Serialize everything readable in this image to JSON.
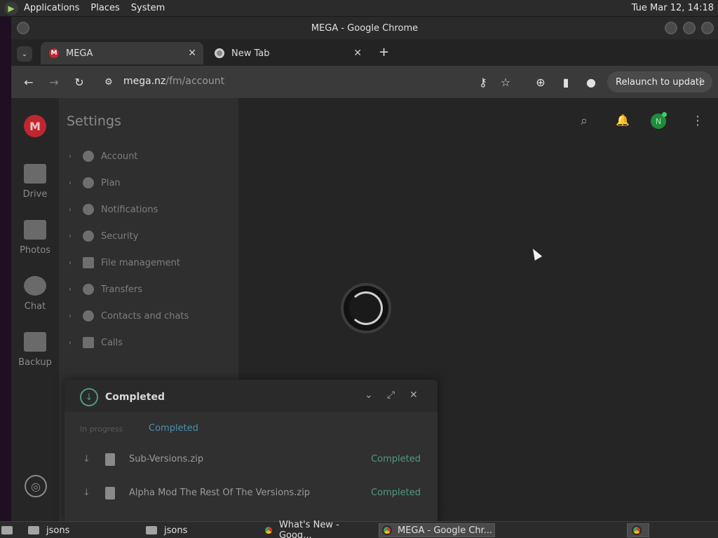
{
  "top_panel": {
    "menus": [
      "Applications",
      "Places",
      "System"
    ],
    "clock": "Tue Mar 12, 14:18"
  },
  "window": {
    "title": "MEGA - Google Chrome"
  },
  "tabs": [
    {
      "label": "MEGA",
      "active": true,
      "favicon": "mega-icon"
    },
    {
      "label": "New Tab",
      "active": false,
      "favicon": "chrome-icon"
    }
  ],
  "toolbar": {
    "url_host": "mega.nz",
    "url_path": "/fm/account",
    "relaunch_label": "Relaunch to update"
  },
  "rail": {
    "logo": "M",
    "items": [
      {
        "label": "Drive",
        "icon": "folder-icon"
      },
      {
        "label": "Photos",
        "icon": "photo-icon"
      },
      {
        "label": "Chat",
        "icon": "chat-bubble-icon"
      },
      {
        "label": "Backup",
        "icon": "device-icon"
      }
    ]
  },
  "settings": {
    "title": "Settings",
    "items": [
      {
        "label": "Account",
        "icon": "user-icon"
      },
      {
        "label": "Plan",
        "icon": "shield-icon"
      },
      {
        "label": "Notifications",
        "icon": "bell-icon"
      },
      {
        "label": "Security",
        "icon": "lock-icon"
      },
      {
        "label": "File management",
        "icon": "folder-icon"
      },
      {
        "label": "Transfers",
        "icon": "transfer-icon"
      },
      {
        "label": "Contacts and chats",
        "icon": "chat-icon"
      },
      {
        "label": "Calls",
        "icon": "camera-icon"
      }
    ]
  },
  "header": {
    "avatar_initial": "N"
  },
  "transfers": {
    "title": "Completed",
    "tab_in_progress": "In progress",
    "tab_completed": "Completed",
    "rows": [
      {
        "name": "Sub-Versions.zip",
        "status": "Completed"
      },
      {
        "name": "Alpha Mod The Rest Of The Versions.zip",
        "status": "Completed"
      }
    ]
  },
  "taskbar": {
    "items": [
      {
        "label": "jsons",
        "icon": "folder-icon"
      },
      {
        "label": "jsons",
        "icon": "folder-icon"
      },
      {
        "label": "What's New - Goog...",
        "icon": "chrome-icon"
      },
      {
        "label": "MEGA - Google Chr...",
        "icon": "chrome-icon"
      }
    ]
  },
  "colors": {
    "mega_red": "#c0262f",
    "completed_green": "#4d9b7d",
    "accent_blue": "#4c8fb0"
  }
}
